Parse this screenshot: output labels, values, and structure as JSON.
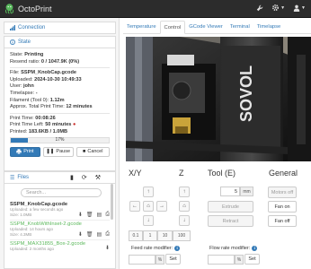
{
  "app": {
    "title": "OctoPrint"
  },
  "navbar": {
    "icons": [
      "wrench-icon",
      "settings-icon",
      "user-icon"
    ]
  },
  "sidebar": {
    "connection": {
      "label": "Connection"
    },
    "state": {
      "label": "State",
      "state_label": "State:",
      "state_value": "Printing",
      "resend_label": "Resend ratio:",
      "resend_value": "0 / 1047.9K (0%)",
      "file_label": "File:",
      "file_value": "SSPM_KnobCap.gcode",
      "uploaded_label": "Uploaded:",
      "uploaded_value": "2024-10-30 10:49:33",
      "user_label": "User:",
      "user_value": "john",
      "timelapse_label": "Timelapse:",
      "timelapse_value": "-",
      "filament_label": "Filament (Tool 0):",
      "filament_value": "1.12m",
      "approx_label": "Approx. Total Print Time:",
      "approx_value": "12 minutes",
      "print_time_label": "Print Time:",
      "print_time_value": "00:08:26",
      "time_left_label": "Print Time Left:",
      "time_left_value": "50 minutes",
      "printed_label": "Printed:",
      "printed_value": "183.6KB / 1.0MB",
      "progress_percent": 17,
      "progress_text": "17%",
      "buttons": {
        "print": "Print",
        "pause": "Pause",
        "cancel": "Cancel"
      }
    },
    "files": {
      "label": "Files",
      "search_placeholder": "Search...",
      "items": [
        {
          "name": "SSPM_KnobCap.gcode",
          "uploaded": "Uploaded: a few seconds ago",
          "size": "Size: 1.0MB"
        },
        {
          "name": "SSPM_KnobWithInset-2.gcode",
          "uploaded": "Uploaded: 14 hours ago",
          "size": "Size: 4.3MB"
        },
        {
          "name": "SSPM_MAX31855_Box-2.gcode",
          "uploaded": "Uploaded: 2 months ago",
          "size": ""
        }
      ]
    }
  },
  "tabs": [
    {
      "label": "Temperature",
      "active": false
    },
    {
      "label": "Control",
      "active": true
    },
    {
      "label": "GCode Viewer",
      "active": false
    },
    {
      "label": "Terminal",
      "active": false
    },
    {
      "label": "Timelapse",
      "active": false
    }
  ],
  "control": {
    "xy_label": "X/Y",
    "z_label": "Z",
    "tool_label": "Tool (E)",
    "general_label": "General",
    "steps": [
      "0.1",
      "1",
      "10",
      "100"
    ],
    "extrude_amount": "5",
    "extrude_unit": "mm",
    "extrude_label": "Extrude",
    "retract_label": "Retract",
    "motors_off": "Motors off",
    "fan_on": "Fan on",
    "fan_off": "Fan off",
    "feed_label": "Feed rate modifier:",
    "flow_label": "Flow rate modifier:",
    "percent": "%",
    "set_label": "Set"
  },
  "webcam": {
    "brand_text": "SOVOL"
  },
  "colors": {
    "accent": "#337ab7",
    "navbar": "#2c2c2c",
    "file_link": "#5cb85c"
  }
}
